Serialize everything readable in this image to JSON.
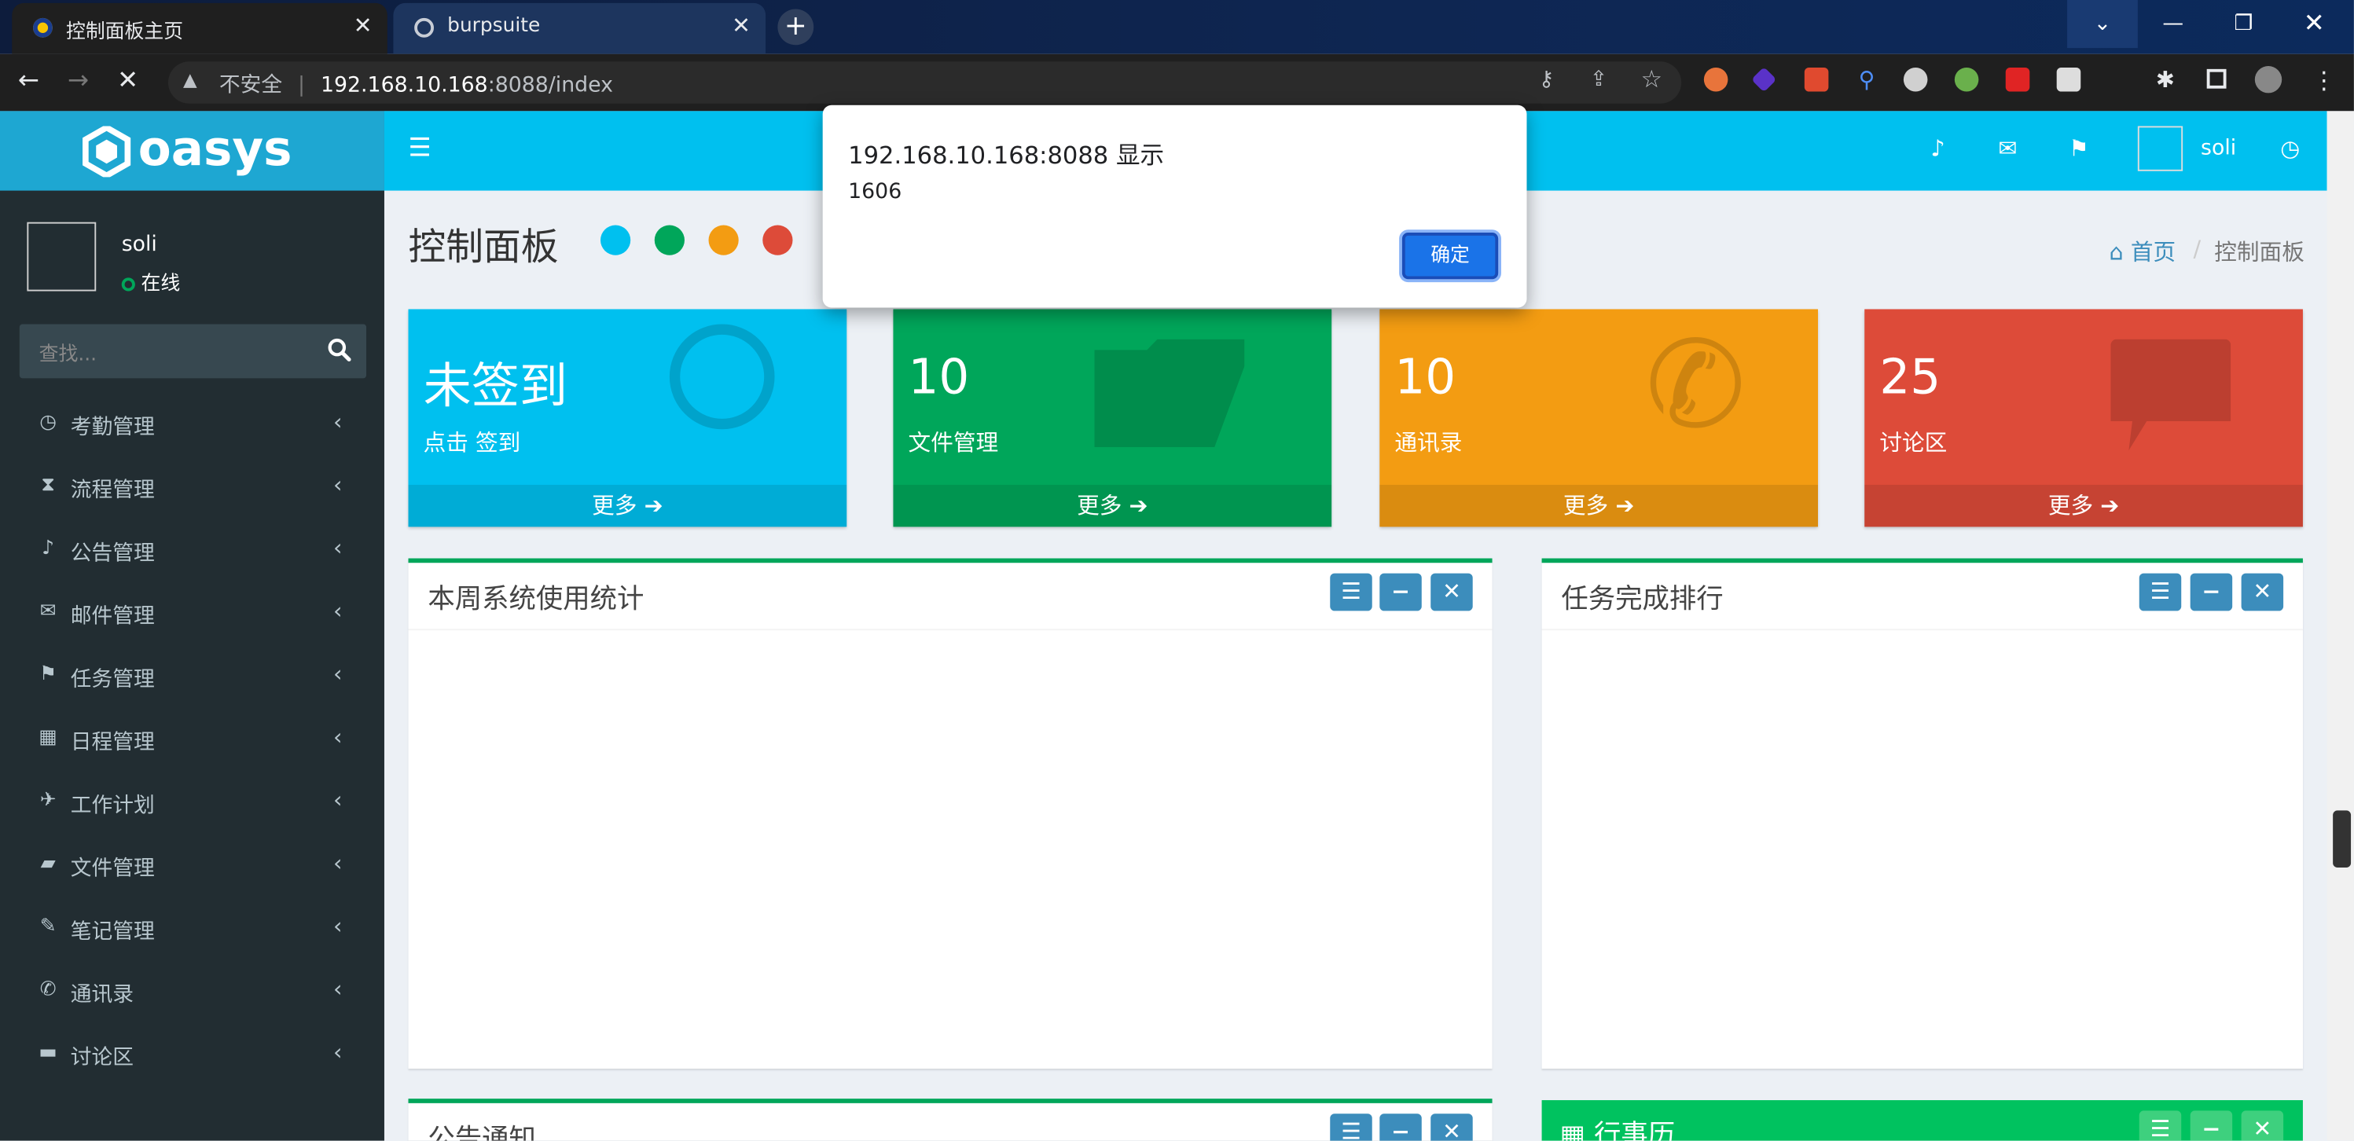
{
  "browser": {
    "tabs": [
      {
        "title": "控制面板主页",
        "active": true
      },
      {
        "title": "burpsuite",
        "active": false
      }
    ],
    "new_tab": "+",
    "address": {
      "security": "不安全",
      "host": "192.168.10.168",
      "rest": ":8088/index"
    }
  },
  "app": {
    "logo": "oasys"
  },
  "user": {
    "name": "soli",
    "status": "在线"
  },
  "sidebar": {
    "search_placeholder": "查找...",
    "items": [
      {
        "label": "考勤管理",
        "icon": "clock-icon"
      },
      {
        "label": "流程管理",
        "icon": "hourglass-icon"
      },
      {
        "label": "公告管理",
        "icon": "bell-icon"
      },
      {
        "label": "邮件管理",
        "icon": "envelope-icon"
      },
      {
        "label": "任务管理",
        "icon": "flag-icon"
      },
      {
        "label": "日程管理",
        "icon": "calendar-icon"
      },
      {
        "label": "工作计划",
        "icon": "plane-icon"
      },
      {
        "label": "文件管理",
        "icon": "folder-icon"
      },
      {
        "label": "笔记管理",
        "icon": "edit-icon"
      },
      {
        "label": "通讯录",
        "icon": "phone-icon"
      },
      {
        "label": "讨论区",
        "icon": "comment-icon"
      }
    ]
  },
  "header": {
    "user_name": "soli"
  },
  "page": {
    "title": "控制面板",
    "breadcrumb": {
      "home": "首页",
      "sep": "/",
      "current": "控制面板"
    },
    "theme_dots": [
      "#00c0ef",
      "#00a65a",
      "#f39c12",
      "#dd4b39"
    ]
  },
  "cards": [
    {
      "big": "未签到",
      "sub": "点击 签到",
      "more": "更多",
      "color": "#00c0ef"
    },
    {
      "big": "10",
      "sub": "文件管理",
      "more": "更多",
      "color": "#00a65a"
    },
    {
      "big": "10",
      "sub": "通讯录",
      "more": "更多",
      "color": "#f39c12"
    },
    {
      "big": "25",
      "sub": "讨论区",
      "more": "更多",
      "color": "#dd4b39"
    }
  ],
  "boxes": {
    "weekly_stats": "本周系统使用统计",
    "task_rank": "任务完成排行",
    "notices": "公告通知",
    "calendar": "行事历"
  },
  "dialog": {
    "title": "192.168.10.168:8088 显示",
    "message": "1606",
    "ok": "确定"
  }
}
